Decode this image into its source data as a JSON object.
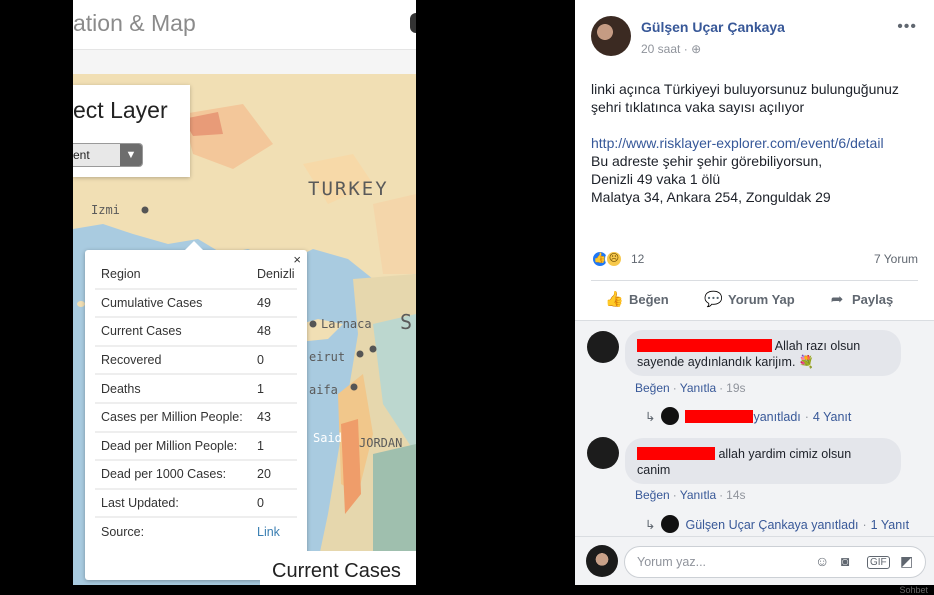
{
  "photo": {
    "app_title": "ation & Map",
    "layer_box": {
      "title": "ect Layer",
      "selected": "ent"
    },
    "map_labels": {
      "turkey": "TURKEY",
      "izmir": "Izmi",
      "larnaca": "Larnaca",
      "beirut": "eirut",
      "haifa": "aifa",
      "jordan": "JORDAN",
      "said": "Said",
      "s": "S"
    },
    "popup": {
      "close": "×",
      "rows": [
        {
          "label": "Region",
          "value": "Denizli"
        },
        {
          "label": "Cumulative Cases",
          "value": "49"
        },
        {
          "label": "Current Cases",
          "value": "48"
        },
        {
          "label": "Recovered",
          "value": "0"
        },
        {
          "label": "Deaths",
          "value": "1"
        },
        {
          "label": "Cases per Million People:",
          "value": "43"
        },
        {
          "label": "Dead per Million People:",
          "value": "1"
        },
        {
          "label": "Dead per 1000 Cases:",
          "value": "20"
        },
        {
          "label": "Last Updated:",
          "value": "0"
        },
        {
          "label": "Source:",
          "value": "Link"
        }
      ]
    },
    "legend_title": "Current Cases"
  },
  "post": {
    "author": "Gülşen Uçar Çankaya",
    "time": "20 saat",
    "privacy_icon": "public-globe-icon",
    "more": "•••",
    "lines": [
      "linki açınca Türkiyeyi buluyorsunuz bulunguğunuz",
      "şehri tıklatınca vaka sayısı açılıyor"
    ],
    "link": "http://www.risklayer-explorer.com/event/6/detail",
    "lines2": [
      "Bu adreste şehir şehir görebiliyorsun,",
      "Denizli 49 vaka 1 ölü",
      "Malatya 34, Ankara 254, Zonguldak 29"
    ],
    "reaction_count": "12",
    "comment_count": "7 Yorum",
    "actions": {
      "like": "Beğen",
      "comment": "Yorum Yap",
      "share": "Paylaş"
    }
  },
  "comments": [
    {
      "text_line1": "Allah razı olsun",
      "text_line2": "sayende aydınlandık karijım.",
      "emoji": "💐",
      "like": "Beğen",
      "reply": "Yanıtla",
      "time": "19s",
      "replies_by": "yanıtladı",
      "replies_count": "4 Yanıt"
    },
    {
      "text_line1": "allah yardim cimiz olsun",
      "text_line2": "canim",
      "like": "Beğen",
      "reply": "Yanıtla",
      "time": "14s",
      "replies_by": "Gülşen Uçar Çankaya yanıtladı",
      "replies_count": "1 Yanıt"
    }
  ],
  "composer": {
    "placeholder": "Yorum yaz..."
  },
  "footer": {
    "chat": "Sohbet"
  }
}
